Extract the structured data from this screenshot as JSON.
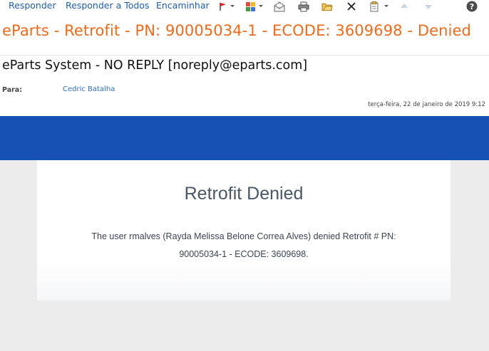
{
  "toolbar": {
    "reply_label": "Responder",
    "reply_all_label": "Responder a Todos",
    "forward_label": "Encaminhar",
    "icons": [
      "flag-icon",
      "categories-icon",
      "mark-read-icon",
      "print-icon",
      "move-folder-icon",
      "delete-icon",
      "rules-icon",
      "up-arrow-icon",
      "down-arrow-icon",
      "help-icon"
    ]
  },
  "message": {
    "subject": "eParts - Retrofit - PN: 90005034-1 - ECODE: 3609698 - Denied",
    "sender": "eParts System - NO REPLY [noreply@eparts.com]",
    "to_label": "Para:",
    "to_value": "Cedric Batalha",
    "date": "terça-feira, 22 de janeiro de 2019 9:12"
  },
  "email_body": {
    "title": "Retrofit Denied",
    "line1": "The user rmalves (Rayda Melissa Belone Correa Alves) denied Retrofit # PN:",
    "line2": "90005034-1 - ECODE: 3609698.",
    "banner_color": "#1552b3",
    "accent_color": "#f06a1c"
  }
}
